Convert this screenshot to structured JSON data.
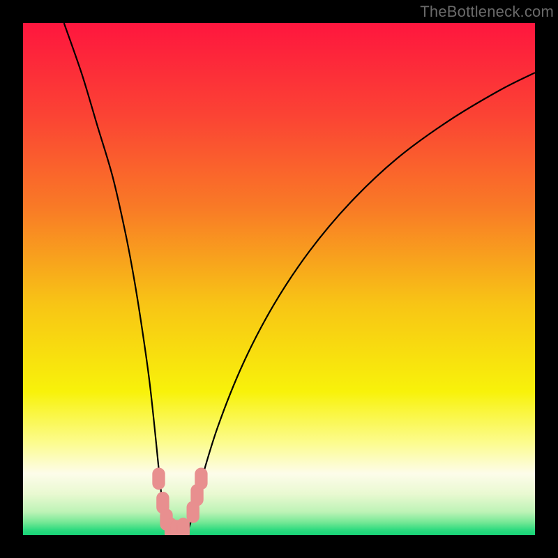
{
  "watermark": "TheBottleneck.com",
  "colors": {
    "frame": "#000000",
    "curve": "#000000",
    "marker_fill": "#e88f8f",
    "marker_stroke": "#e88f8f",
    "gradient_stops": [
      {
        "offset": 0.0,
        "color": "#fe163e"
      },
      {
        "offset": 0.18,
        "color": "#fb4334"
      },
      {
        "offset": 0.36,
        "color": "#f97a26"
      },
      {
        "offset": 0.55,
        "color": "#f8c515"
      },
      {
        "offset": 0.72,
        "color": "#f8f20a"
      },
      {
        "offset": 0.82,
        "color": "#fcfc8e"
      },
      {
        "offset": 0.88,
        "color": "#fdfcea"
      },
      {
        "offset": 0.92,
        "color": "#e9f9d1"
      },
      {
        "offset": 0.955,
        "color": "#bdf3b6"
      },
      {
        "offset": 0.975,
        "color": "#76e896"
      },
      {
        "offset": 0.99,
        "color": "#2edb7f"
      },
      {
        "offset": 1.0,
        "color": "#17d477"
      }
    ]
  },
  "chart_data": {
    "type": "line",
    "title": "",
    "xlabel": "",
    "ylabel": "",
    "xlim": [
      0,
      1000
    ],
    "ylim": [
      0,
      1000
    ],
    "series": [
      {
        "name": "bottleneck-curve",
        "points": [
          [
            80,
            1000
          ],
          [
            115,
            900
          ],
          [
            145,
            800
          ],
          [
            175,
            700
          ],
          [
            200,
            590
          ],
          [
            217,
            500
          ],
          [
            233,
            400
          ],
          [
            247,
            300
          ],
          [
            258,
            200
          ],
          [
            268,
            100
          ],
          [
            275,
            40
          ],
          [
            283,
            10
          ],
          [
            295,
            0
          ],
          [
            310,
            0
          ],
          [
            322,
            10
          ],
          [
            332,
            40
          ],
          [
            345,
            95
          ],
          [
            380,
            210
          ],
          [
            430,
            335
          ],
          [
            490,
            450
          ],
          [
            560,
            555
          ],
          [
            640,
            650
          ],
          [
            730,
            735
          ],
          [
            830,
            808
          ],
          [
            930,
            868
          ],
          [
            1000,
            903
          ]
        ]
      }
    ],
    "markers": [
      {
        "x": 265,
        "y": 110
      },
      {
        "x": 273,
        "y": 63
      },
      {
        "x": 280,
        "y": 30
      },
      {
        "x": 289,
        "y": 12
      },
      {
        "x": 300,
        "y": 8
      },
      {
        "x": 313,
        "y": 12
      },
      {
        "x": 332,
        "y": 45
      },
      {
        "x": 340,
        "y": 78
      },
      {
        "x": 348,
        "y": 110
      }
    ]
  }
}
